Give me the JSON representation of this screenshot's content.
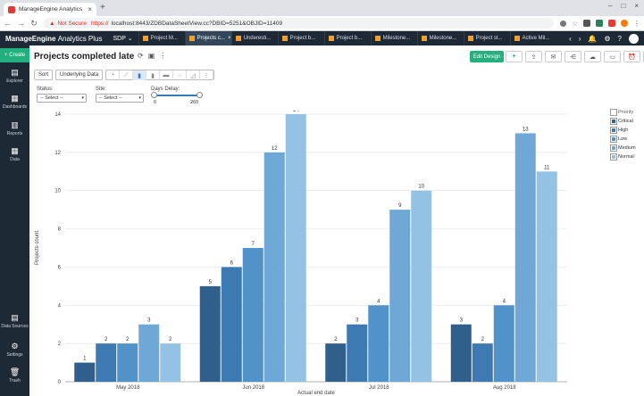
{
  "browser": {
    "tab_title": "ManageEngine Analytics Plus",
    "security": "Not Secure",
    "url_proto": "https://",
    "url_rest": "localhost:8443/ZDBDataSheetView.cc?DBID=5251&OBJID=11409"
  },
  "app": {
    "brand": "ManageEngine",
    "brand_product": "Analytics Plus",
    "workspace": "SDP",
    "tabs": [
      "Project M...",
      "Projects c...",
      "Underesti...",
      "Project b...",
      "Project b...",
      "Milestone...",
      "Milestone...",
      "Project st...",
      "Active Mil..."
    ]
  },
  "sidebar": {
    "create": "Create",
    "items": [
      "Explorer",
      "Dashboards",
      "Reports",
      "Data",
      "Data Sources",
      "Settings",
      "Trash"
    ]
  },
  "page": {
    "title": "Projects completed late",
    "edit_design": "Edit Design"
  },
  "toolbar": {
    "sort": "Sort",
    "underlying": "Underlying Data"
  },
  "filters": {
    "status_label": "Status:",
    "status_value": "-- Select --",
    "site_label": "Site:",
    "site_value": "-- Select --",
    "delay_label": "Days Delay:",
    "delay_min": "0",
    "delay_max": "260"
  },
  "colors": {
    "Critical": "#2f5f8a",
    "High": "#3d7ab2",
    "Low": "#5192c8",
    "Medium": "#6fa8d6",
    "Normal": "#94c2e4"
  },
  "chart_data": {
    "type": "bar",
    "title": "",
    "xlabel": "Actual end date",
    "ylabel": "Projects count",
    "ylim": [
      0,
      14
    ],
    "yticks": [
      0,
      2,
      4,
      6,
      8,
      10,
      12,
      14
    ],
    "grid": true,
    "legend_title": "Priority",
    "legend_position": "right",
    "categories": [
      "May 2018",
      "Jun 2018",
      "Jul 2018",
      "Aug 2018"
    ],
    "series": [
      {
        "name": "Critical",
        "values": [
          1,
          5,
          2,
          3
        ]
      },
      {
        "name": "High",
        "values": [
          2,
          6,
          3,
          2
        ]
      },
      {
        "name": "Low",
        "values": [
          2,
          7,
          4,
          4
        ]
      },
      {
        "name": "Medium",
        "values": [
          3,
          12,
          9,
          13
        ]
      },
      {
        "name": "Normal",
        "values": [
          2,
          14,
          10,
          11
        ]
      }
    ]
  }
}
